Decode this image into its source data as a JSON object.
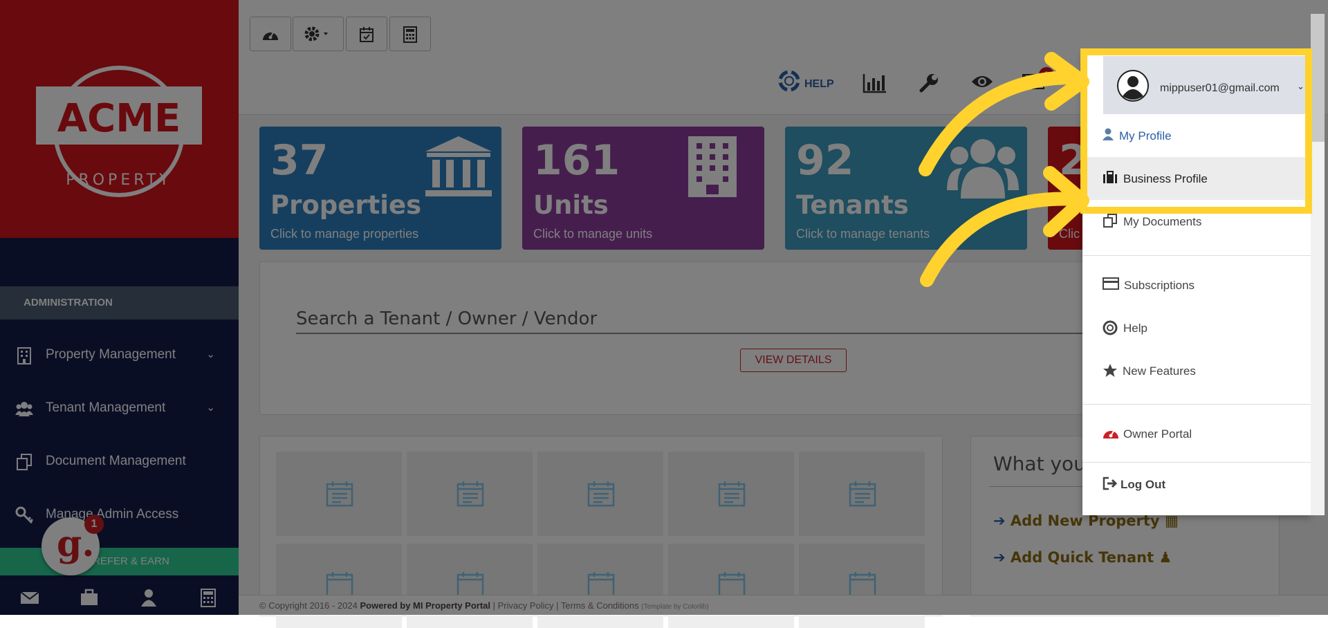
{
  "sidebar": {
    "logo_brand": "ACME",
    "logo_tagline": "PROPERTY",
    "admin_header": "ADMINISTRATION",
    "items": [
      {
        "label": "Property Management",
        "has_submenu": true,
        "icon": "building-icon"
      },
      {
        "label": "Tenant Management",
        "has_submenu": true,
        "icon": "users-icon"
      },
      {
        "label": "Document Management",
        "has_submenu": false,
        "icon": "documents-icon"
      },
      {
        "label": "Manage Admin Access",
        "has_submenu": false,
        "icon": "key-icon"
      }
    ],
    "refer_label": "REFER & EARN",
    "badge_letter": "g.",
    "badge_count": "1",
    "bottom_icons": [
      "envelope-icon",
      "briefcase-icon",
      "user-icon",
      "calculator-icon"
    ]
  },
  "toolbar": {
    "buttons": [
      "dashboard-icon",
      "settings-dropdown-icon",
      "calendar-check-icon",
      "calculator-icon"
    ]
  },
  "header": {
    "help_label": "HELP",
    "mail_badge": "1",
    "icons": [
      "chart-icon",
      "wrench-icon",
      "eye-icon",
      "envelope-icon"
    ]
  },
  "cards": [
    {
      "number": "37",
      "title": "Properties",
      "subtitle": "Click to manage properties",
      "color": "#2d7fbf",
      "icon": "bank-icon"
    },
    {
      "number": "161",
      "title": "Units",
      "subtitle": "Click to manage units",
      "color": "#8a3c9c",
      "icon": "building-icon"
    },
    {
      "number": "92",
      "title": "Tenants",
      "subtitle": "Click to manage tenants",
      "color": "#3d9cbf",
      "icon": "users-icon"
    },
    {
      "number": "2",
      "title": "",
      "subtitle": "Clic",
      "color": "#d3141c",
      "icon": ""
    }
  ],
  "search": {
    "placeholder": "Search a Tenant / Owner / Vendor",
    "button_label": "VIEW DETAILS"
  },
  "what_panel": {
    "title": "What you",
    "actions": [
      "Add New Property",
      "Add Quick Tenant"
    ]
  },
  "footer": {
    "copyright": "© Copyright 2016 - 2024",
    "powered": "Powered by MI Property Portal",
    "links": [
      "Privacy Policy",
      "Terms & Conditions"
    ],
    "template": "(Template by Colorlib)"
  },
  "dropdown": {
    "email": "mippuser01@gmail.com",
    "items": [
      {
        "label": "My Profile",
        "icon": "user-icon",
        "highlighted": true
      },
      {
        "label": "Business Profile",
        "icon": "briefcase-icon",
        "hovered": true
      },
      {
        "label": "My Documents",
        "icon": "documents-icon"
      },
      {
        "label": "Subscriptions",
        "icon": "credit-card-icon"
      },
      {
        "label": "Help",
        "icon": "lifebuoy-icon"
      },
      {
        "label": "New Features",
        "icon": "star-icon"
      },
      {
        "label": "Owner Portal",
        "icon": "dashboard-icon"
      },
      {
        "label": "Log Out",
        "icon": "sign-out-icon"
      }
    ]
  },
  "colors": {
    "sidebar_bg": "#141d4b",
    "brand_red": "#d3141c",
    "highlight_yellow": "#ffd22e",
    "refer_green": "#2ecc95"
  }
}
